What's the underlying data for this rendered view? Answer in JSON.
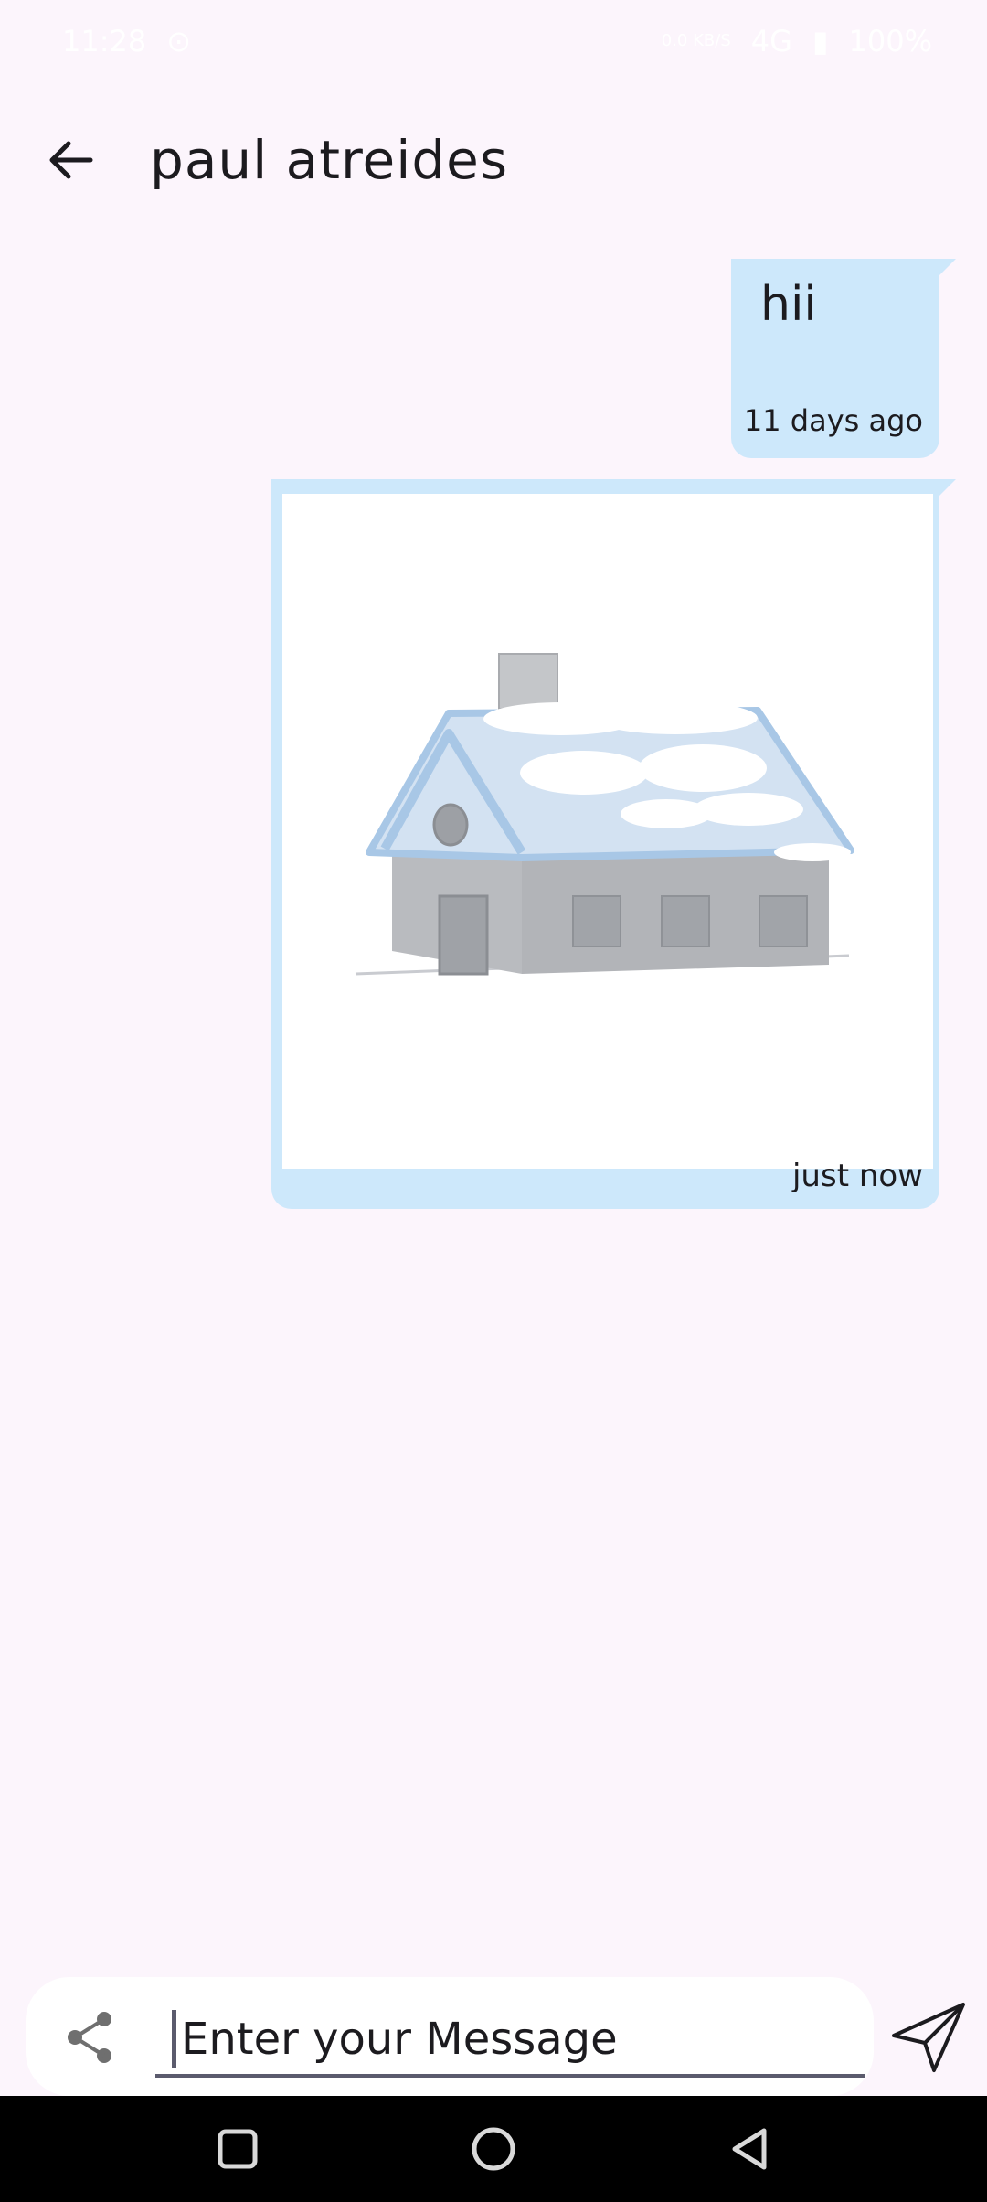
{
  "status_bar": {
    "time": "11:28",
    "network_speed": "0.0 KB/S",
    "signal": "4G",
    "battery": "100%"
  },
  "header": {
    "title": "paul atreides",
    "back_icon": "arrow-left-icon"
  },
  "messages": [
    {
      "type": "text",
      "text": "hii",
      "time": "11 days ago"
    },
    {
      "type": "image",
      "image": "snow-covered-house",
      "time": "just now"
    }
  ],
  "composer": {
    "placeholder": "Enter your Message",
    "value": "",
    "share_icon": "share-icon",
    "send_icon": "send-icon"
  },
  "colors": {
    "background": "#fcf5fc",
    "bubble": "#cde8fb",
    "text": "#1c1b1f"
  },
  "nav_bar": {
    "icons": [
      "recent-apps-icon",
      "home-icon",
      "back-icon"
    ]
  }
}
